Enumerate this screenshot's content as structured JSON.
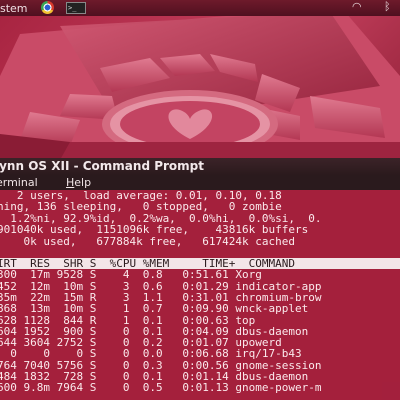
{
  "panel": {
    "label": "stem",
    "terminal_icon_text": ">_"
  },
  "window": {
    "title": "lynn OS XII - Command Prompt"
  },
  "menu": {
    "terminal": "erminal",
    "help": "Help"
  },
  "summary": {
    "line1": "   2 users,  load average: 0.01, 0.10, 0.18",
    "line2": "ning, 136 sleeping,   0 stopped,   0 zombie",
    "line3": "  1.2%ni, 92.9%id,  0.2%wa,  0.0%hi,  0.0%si,  0.",
    "line4": "901040k used,  1151096k free,    43816k buffers",
    "line5": "    0k used,   677884k free,   617424k cached"
  },
  "table": {
    "header": "IRT  RES  SHR S  %CPU %MEM     TIME+  COMMAND",
    "rows": [
      "300  17m 9528 S    4  0.8   0:51.61 Xorg",
      "452  12m  10m S    3  0.6   0:01.29 indicator-app",
      "35m  22m  15m R    3  1.1   0:31.01 chromium-brow",
      "868  13m  10m S    1  0.7   0:09.90 wnck-applet",
      "628 1128  844 R    1  0.1   0:00.63 top",
      "604 1952  900 S    0  0.1   0:04.09 dbus-daemon",
      "644 3604 2752 S    0  0.2   0:01.07 upowerd",
      "  0    0    0 S    0  0.0   0:06.68 irq/17-b43",
      "764 7040 5756 S    0  0.3   0:00.56 gnome-session",
      "484 1832  728 S    0  0.1   0:01.14 dbus-daemon",
      "600 9.8m 7964 S    0  0.5   0:01.13 gnome-power-m"
    ]
  },
  "colors": {
    "wallpaper": "#b8304f",
    "terminal_bg": "#a01e3a",
    "header_bg": "#f3e5e8"
  }
}
